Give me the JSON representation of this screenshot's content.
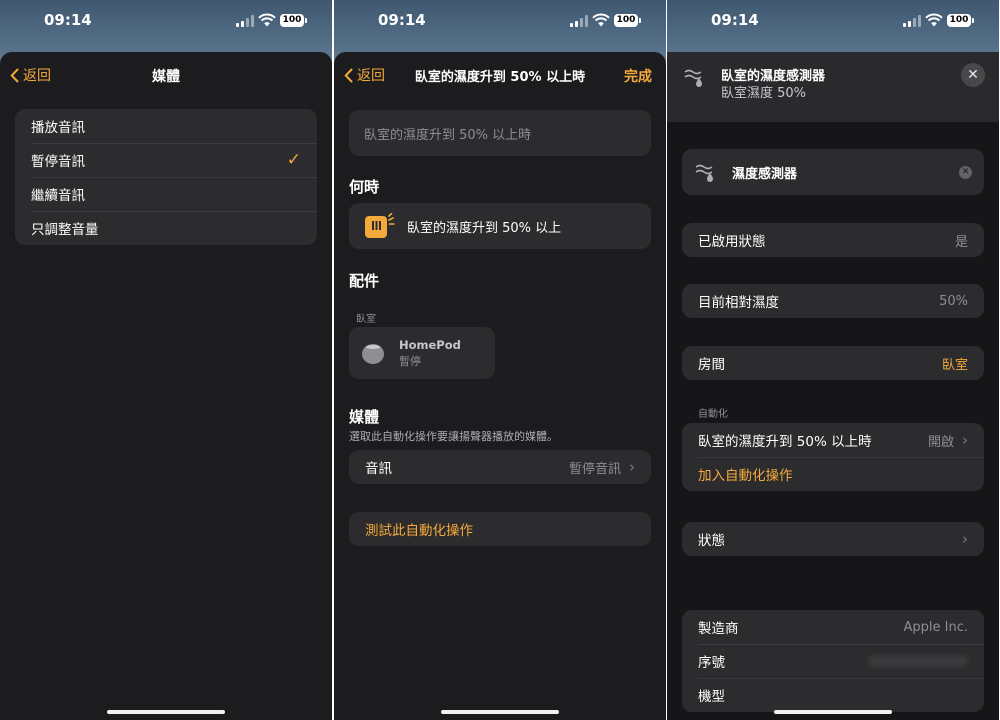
{
  "status": {
    "time": "09:14",
    "battery": "100"
  },
  "panel1": {
    "back_label": "返回",
    "title": "媒體",
    "options": [
      {
        "label": "播放音訊",
        "selected": false
      },
      {
        "label": "暫停音訊",
        "selected": true
      },
      {
        "label": "繼續音訊",
        "selected": false
      },
      {
        "label": "只調整音量",
        "selected": false
      }
    ]
  },
  "panel2": {
    "back_label": "返回",
    "title": "臥室的濕度升到 50% 以上時",
    "done_label": "完成",
    "name_placeholder": "臥室的濕度升到 50% 以上時",
    "when_title": "何時",
    "trigger_text": "臥室的濕度升到 50% 以上",
    "accessories_title": "配件",
    "room_label": "臥室",
    "accessory": {
      "name": "HomePod",
      "status": "暫停"
    },
    "media_title": "媒體",
    "media_desc": "選取此自動化操作要讓揚聲器播放的媒體。",
    "audio_label": "音訊",
    "audio_value": "暫停音訊",
    "test_label": "測試此自動化操作"
  },
  "panel3": {
    "sensor_title": "臥室的濕度感測器",
    "sensor_subtitle": "臥室濕度 50%",
    "card_name": "濕度感測器",
    "enabled_label": "已啟用狀態",
    "enabled_value": "是",
    "humidity_label": "目前相對濕度",
    "humidity_value": "50%",
    "room_label": "房間",
    "room_value": "臥室",
    "automation_section": "自動化",
    "automation_name": "臥室的濕度升到 50% 以上時",
    "automation_state": "開啟",
    "add_automation": "加入自動化操作",
    "status_label": "狀態",
    "manufacturer_label": "製造商",
    "manufacturer_value": "Apple Inc.",
    "serial_label": "序號",
    "model_label": "機型"
  },
  "colors": {
    "accent": "#f4a93b",
    "sheet": "#1c1c1e",
    "card": "#2c2c2e"
  }
}
